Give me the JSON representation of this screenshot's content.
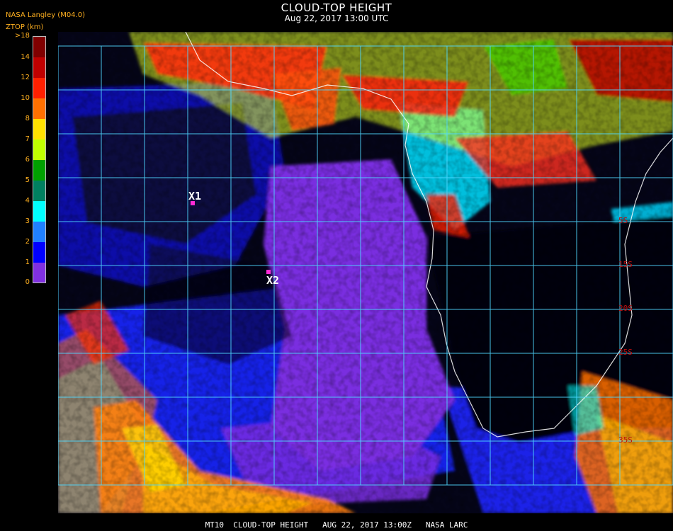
{
  "header": {
    "title": "CLOUD-TOP HEIGHT",
    "subtitle": "Aug 22, 2017 13:00 UTC",
    "brand": "NASA Langley (M04.0)",
    "unit": "ZTOP (km)"
  },
  "legend": {
    "labels": [
      ">18",
      "14",
      "12",
      "10",
      "8",
      "7",
      "6",
      "5",
      "4",
      "3",
      "2",
      "1",
      "0"
    ],
    "colors": [
      "#800000",
      "#c00000",
      "#ff2000",
      "#ff7000",
      "#ffa000",
      "#ffe000",
      "#c0ff00",
      "#40d000",
      "#00a000",
      "#008060",
      "#00ffff",
      "#2080ff",
      "#0000ff",
      "#8030e0"
    ]
  },
  "map": {
    "markers": [
      {
        "label": "X1"
      },
      {
        "label": "X2"
      }
    ],
    "lat_labels": [
      "5S",
      "15S",
      "20S",
      "25S",
      "35S"
    ]
  },
  "footer": "MT10  CLOUD-TOP HEIGHT   AUG 22, 2017 13:00Z   NASA LARC"
}
